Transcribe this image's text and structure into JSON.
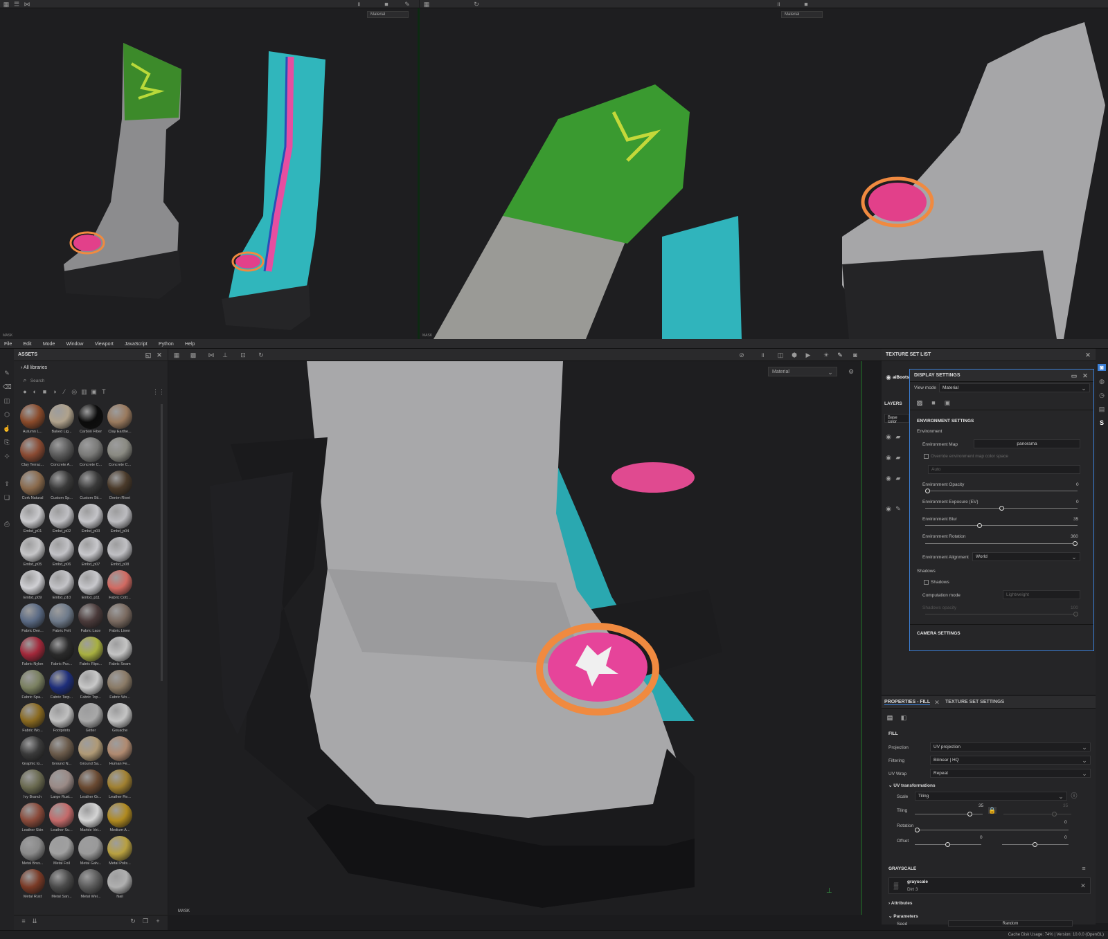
{
  "top_left_viewport": {
    "mode_select": "Material",
    "mask_label": "MASK"
  },
  "top_right_viewport": {
    "mode_select": "Material",
    "mask_label": "MASK"
  },
  "menu": {
    "items": [
      "File",
      "Edit",
      "Mode",
      "Window",
      "Viewport",
      "JavaScript",
      "Python",
      "Help"
    ]
  },
  "assets": {
    "title": "ASSETS",
    "library": "All libraries",
    "search_placeholder": "Search",
    "items": [
      {
        "label": "Autumn L...",
        "color": "#8a4a2a"
      },
      {
        "label": "Baked Lig...",
        "color": "#b0a28c"
      },
      {
        "label": "Carbon Fiber",
        "color": "#0b0b0b"
      },
      {
        "label": "Clay Earthe...",
        "color": "#9a7a5e"
      },
      {
        "label": "Clay Terrac...",
        "color": "#8a4a32"
      },
      {
        "label": "Concrete A...",
        "color": "#5a5a5a"
      },
      {
        "label": "Concrete C...",
        "color": "#7a7a78"
      },
      {
        "label": "Concrete C...",
        "color": "#8a8a82"
      },
      {
        "label": "Cork Natural",
        "color": "#8a6a4c"
      },
      {
        "label": "Custom Sp...",
        "color": "#3a3a3a"
      },
      {
        "label": "Custom Sti...",
        "color": "#3a3a3a"
      },
      {
        "label": "Denim Rivet",
        "color": "#4a3a2a"
      },
      {
        "label": "Embd_p01",
        "color": "#c9c9cc"
      },
      {
        "label": "Embd_p02",
        "color": "#c0c0c4"
      },
      {
        "label": "Embd_p03",
        "color": "#c4c4c8"
      },
      {
        "label": "Embd_p04",
        "color": "#bcbcc0"
      },
      {
        "label": "Embd_p05",
        "color": "#c6c6c8"
      },
      {
        "label": "Embd_p06",
        "color": "#c2c2c6"
      },
      {
        "label": "Embd_p07",
        "color": "#c8c8cc"
      },
      {
        "label": "Embd_p08",
        "color": "#c0c0c4"
      },
      {
        "label": "Embd_p09",
        "color": "#d0d0d4"
      },
      {
        "label": "Embd_p10",
        "color": "#c4c4c8"
      },
      {
        "label": "Embd_p11",
        "color": "#c8c8cc"
      },
      {
        "label": "Fabric Cott...",
        "color": "#d26a62"
      },
      {
        "label": "Fabric Den...",
        "color": "#5a6a84"
      },
      {
        "label": "Fabric Felt",
        "color": "#6e7a8a"
      },
      {
        "label": "Fabric Lace",
        "color": "#4a3a3a"
      },
      {
        "label": "Fabric Linen",
        "color": "#7a6a60"
      },
      {
        "label": "Fabric Nylon",
        "color": "#a2283a"
      },
      {
        "label": "Fabric Puc...",
        "color": "#2a2a2a"
      },
      {
        "label": "Fabric Rips...",
        "color": "#a8b040"
      },
      {
        "label": "Fabric Seam",
        "color": "#c4c4c4"
      },
      {
        "label": "Fabric Spa...",
        "color": "#7a8060"
      },
      {
        "label": "Fabric Tarp...",
        "color": "#1e2e7a"
      },
      {
        "label": "Fabric Top...",
        "color": "#c8c8c8"
      },
      {
        "label": "Fabric Wo...",
        "color": "#8a7a66"
      },
      {
        "label": "Fabric Wo...",
        "color": "#8a6a20"
      },
      {
        "label": "Footprints",
        "color": "#c0c0c0"
      },
      {
        "label": "Glitter",
        "color": "#a8a8a8"
      },
      {
        "label": "Gouache",
        "color": "#c4c4c4"
      },
      {
        "label": "Graphic to...",
        "color": "#3a3a3a"
      },
      {
        "label": "Ground N...",
        "color": "#6a5a4a"
      },
      {
        "label": "Ground Sa...",
        "color": "#b09a76"
      },
      {
        "label": "Human Fe...",
        "color": "#b08a70"
      },
      {
        "label": "Ivy Branch",
        "color": "#6a6a50"
      },
      {
        "label": "Large Rust...",
        "color": "#9a8a86"
      },
      {
        "label": "Leather Gr...",
        "color": "#6a4a32"
      },
      {
        "label": "Leather Re...",
        "color": "#a08030"
      },
      {
        "label": "Leather Skin",
        "color": "#8a4a3a"
      },
      {
        "label": "Leather Su...",
        "color": "#c46a6a"
      },
      {
        "label": "Marble Vei...",
        "color": "#d4d4d4"
      },
      {
        "label": "Medium A...",
        "color": "#b08a20"
      },
      {
        "label": "Metal Brus...",
        "color": "#8a8a8a"
      },
      {
        "label": "Metal Foil",
        "color": "#a0a0a0"
      },
      {
        "label": "Metal Galv...",
        "color": "#9a9a9a"
      },
      {
        "label": "Metal Polis...",
        "color": "#b8a040"
      },
      {
        "label": "Metal Rust",
        "color": "#7a3a26"
      },
      {
        "label": "Metal San...",
        "color": "#4a4a4a"
      },
      {
        "label": "Metal Wei...",
        "color": "#5a5a5a"
      },
      {
        "label": "Nail",
        "color": "#b0b0b0"
      }
    ]
  },
  "main_viewport": {
    "mode_select": "Material",
    "mask_label": "MASK"
  },
  "texture_set_list": {
    "title": "TEXTURE SET LIST",
    "item": "aiBoots",
    "layers_label": "LAYERS",
    "channel": "Base color"
  },
  "display_settings": {
    "title": "DISPLAY SETTINGS",
    "view_mode_label": "View mode",
    "view_mode_value": "Material",
    "env_section": "ENVIRONMENT SETTINGS",
    "environment": "Environment",
    "env_map_label": "Environment Map",
    "env_map_value": "panorama",
    "override_label": "Override environment map color space",
    "auto_value": "Auto",
    "opacity_label": "Environment Opacity",
    "opacity_value": "0",
    "opacity_frac": 0.0,
    "exposure_label": "Environment Exposure (EV)",
    "exposure_value": "0",
    "exposure_frac": 0.5,
    "blur_label": "Environment Blur",
    "blur_value": "35",
    "blur_frac": 0.35,
    "rotation_label": "Environment Rotation",
    "rotation_value": "360",
    "rotation_frac": 1.0,
    "alignment_label": "Environment Alignment",
    "alignment_value": "World",
    "shadows_section": "Shadows",
    "shadows_check": "Shadows",
    "computation_label": "Computation mode",
    "computation_value": "Lightweight",
    "shadow_opacity_label": "Shadows opacity",
    "shadow_opacity_value": "100",
    "camera_section": "CAMERA SETTINGS"
  },
  "properties": {
    "tab_fill": "PROPERTIES - FILL",
    "tab_texset": "TEXTURE SET SETTINGS",
    "fill_section": "FILL",
    "projection_label": "Projection",
    "projection_value": "UV projection",
    "filtering_label": "Filtering",
    "filtering_value": "Bilinear | HQ",
    "uvwrap_label": "UV Wrap",
    "uvwrap_value": "Repeat",
    "uvtrans_label": "UV transformations",
    "scale_label": "Scale",
    "scale_value": "Tiling",
    "tiling_label": "Tiling",
    "tiling_value": "35",
    "tiling_value2": "35",
    "rotation_label": "Rotation",
    "rotation_value": "0",
    "offset_label": "Offset",
    "offset_value1": "0",
    "offset_value2": "0",
    "grayscale_section": "GRAYSCALE",
    "grayscale_name": "grayscale",
    "grayscale_sub": "Dirt 3",
    "attributes_label": "Attributes",
    "parameters_label": "Parameters",
    "seed_label": "Seed",
    "seed_value": "Random"
  },
  "status": {
    "text": "Cache Disk Usage:  74% | Version: 10.0.0 (OpenGL)"
  }
}
